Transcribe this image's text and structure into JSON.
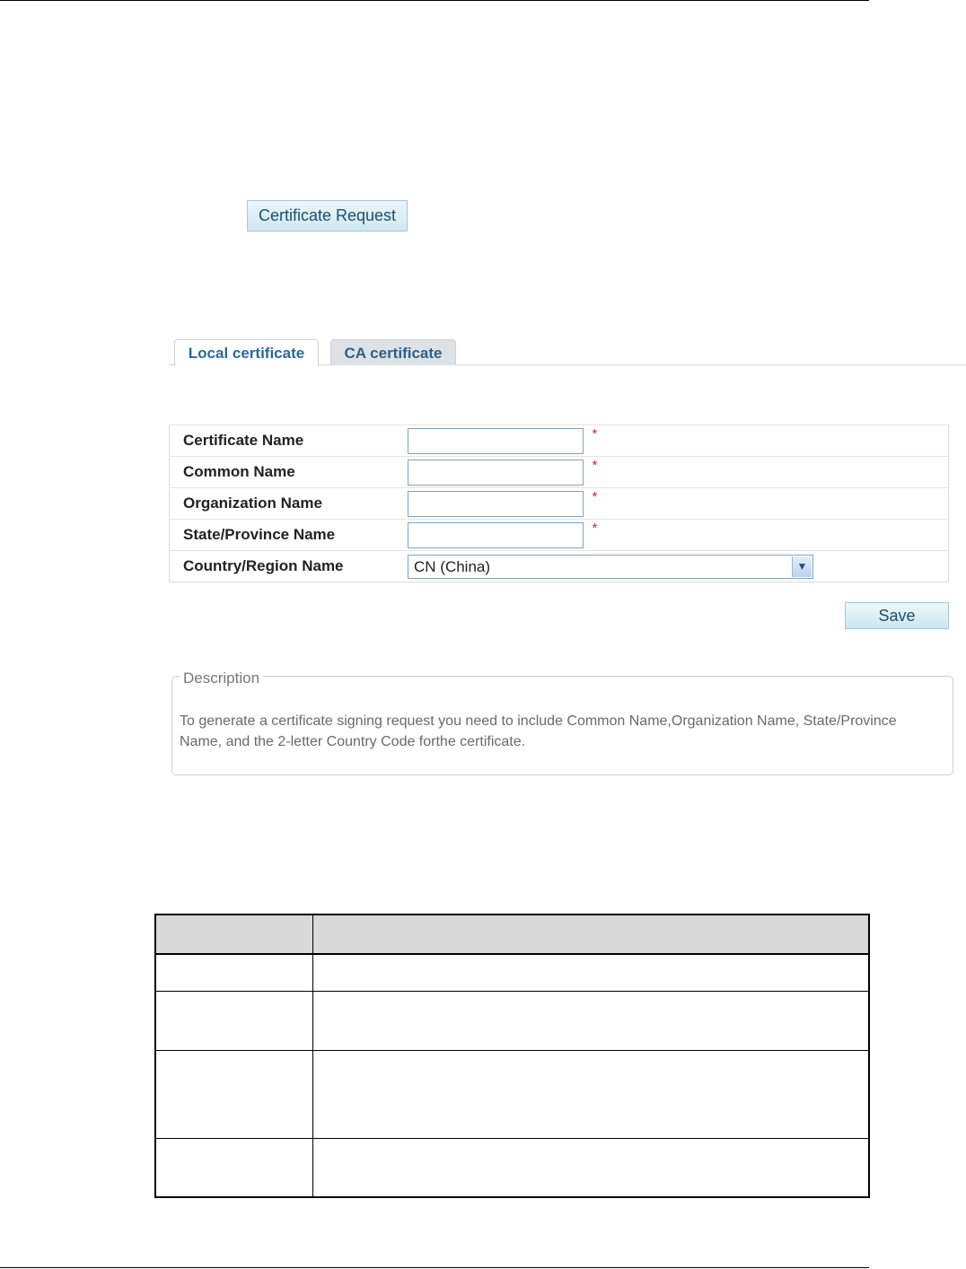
{
  "buttons": {
    "certificate_request": "Certificate Request",
    "save": "Save"
  },
  "tabs": [
    {
      "label": "Local certificate",
      "active": true
    },
    {
      "label": "CA certificate",
      "active": false
    }
  ],
  "form": {
    "rows": [
      {
        "label": "Certificate Name",
        "type": "text",
        "value": "",
        "required": true
      },
      {
        "label": "Common Name",
        "type": "text",
        "value": "",
        "required": true
      },
      {
        "label": "Organization Name",
        "type": "text",
        "value": "",
        "required": true
      },
      {
        "label": "State/Province Name",
        "type": "text",
        "value": "",
        "required": true
      },
      {
        "label": "Country/Region Name",
        "type": "select",
        "value": "CN (China)",
        "required": false
      }
    ],
    "required_mark": "*"
  },
  "description": {
    "legend": "Description",
    "text": "To generate a certificate signing request you need to include Common Name,Organization Name, State/Province Name, and the 2-letter Country Code forthe certificate."
  },
  "colors": {
    "tab_text": "#2a6a9a",
    "required_mark": "#e02020",
    "button_text": "#1d4e6e"
  }
}
